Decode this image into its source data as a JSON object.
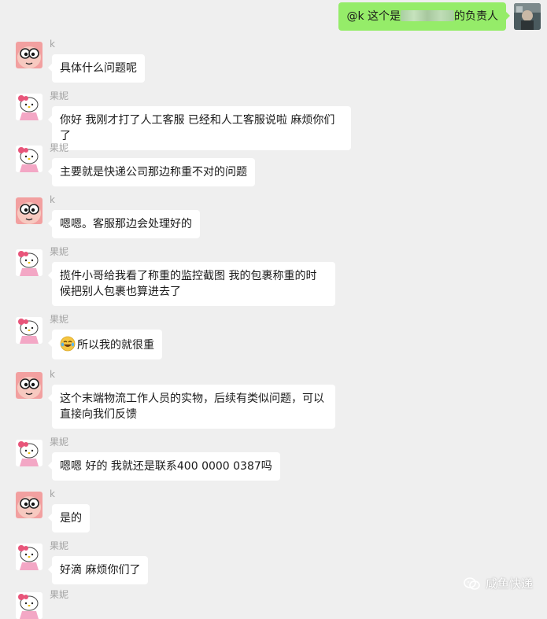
{
  "outgoing": {
    "prefix": "@k   这个是",
    "suffix": "的负责人"
  },
  "messages": [
    {
      "sender": "k",
      "avatar": "cartoon-face",
      "text": "具体什么问题呢"
    },
    {
      "sender": "果妮",
      "avatar": "hello-kitty",
      "text": "你好 我刚才打了人工客服 已经和人工客服说啦 麻烦你们了"
    },
    {
      "sender": "果妮",
      "avatar": "hello-kitty",
      "text": "主要就是快递公司那边称重不对的问题"
    },
    {
      "sender": "k",
      "avatar": "cartoon-face",
      "text": "嗯嗯。客服那边会处理好的"
    },
    {
      "sender": "果妮",
      "avatar": "hello-kitty",
      "text": "揽件小哥给我看了称重的监控截图 我的包裹称重的时候把别人包裹也算进去了"
    },
    {
      "sender": "果妮",
      "avatar": "hello-kitty",
      "emoji": "laugh-cry",
      "text": "所以我的就很重"
    },
    {
      "sender": "k",
      "avatar": "cartoon-face",
      "text": "这个末端物流工作人员的实物，后续有类似问题，可以直接向我们反馈"
    },
    {
      "sender": "果妮",
      "avatar": "hello-kitty",
      "text": "嗯嗯 好的 我就还是联系400 0000 0387吗"
    },
    {
      "sender": "k",
      "avatar": "cartoon-face",
      "text": "是的"
    },
    {
      "sender": "果妮",
      "avatar": "hello-kitty",
      "text": "好滴 麻烦你们了"
    },
    {
      "sender": "果妮",
      "avatar": "hello-kitty",
      "text": ""
    }
  ],
  "watermark": {
    "text": "咸鱼快递",
    "icon": "wechat-channel-icon"
  },
  "colors": {
    "background": "#efefef",
    "bubble_in": "#ffffff",
    "bubble_out": "#95ec69",
    "name": "#a3a3a3"
  }
}
